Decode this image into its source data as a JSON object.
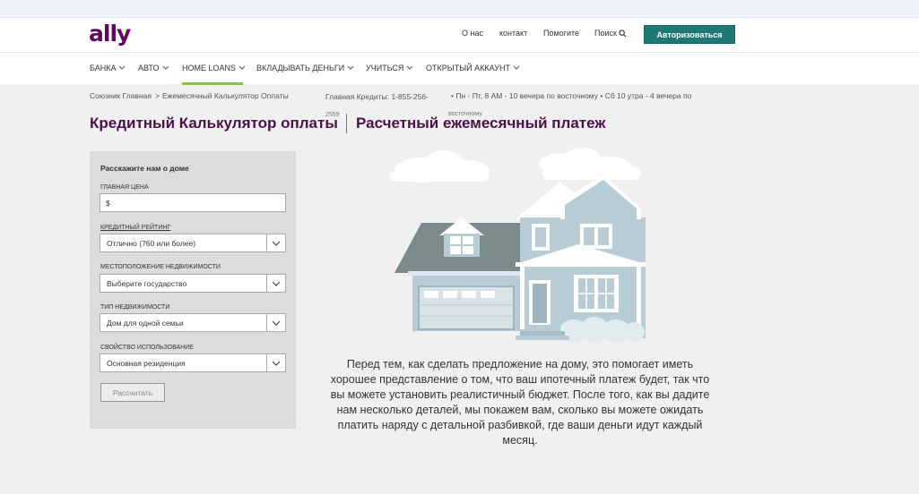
{
  "brand": {
    "logo": "ally",
    "accent": "#650360",
    "button_color": "#1b7a76"
  },
  "header": {
    "links": [
      "О нас",
      "контакт",
      "Помогите"
    ],
    "search_label": "Поиск",
    "login_label": "Авторизоваться"
  },
  "nav": {
    "items": [
      "БАНКА",
      "АВТО",
      "HOME LOANS",
      "ВКЛАДЫВАТЬ ДЕНЬГИ",
      "УЧИТЬСЯ",
      "ОТКРЫТЫЙ АККАУНТ"
    ],
    "active": "HOME LOANS"
  },
  "breadcrumb": {
    "home": "Союзник Главная",
    "separator": ">",
    "current": "Ежемесячный Калькулятор Оплаты"
  },
  "contact": {
    "phone": "Главная Кредиты: 1-855-256-",
    "phone_extra": "2559",
    "hours": "• Пн - Пт, 8 AM - 10 вечера по восточному  • Сб 10 утра - 4 вечера по",
    "hours_extra": "восточному"
  },
  "page": {
    "title_left": "Кредитный Калькулятор оплаты",
    "title_right": "Расчетный ежемесячный платеж"
  },
  "form": {
    "title": "Расскажите нам о доме",
    "price_label": "ГЛАВНАЯ ЦЕНА",
    "price_value": "$",
    "credit_label": "КРЕДИТНЫЙ РЕЙТИНГ",
    "credit_value": "Отлично (760 или более)",
    "location_label": "местоположение недвижимости",
    "location_value": "Выберите государство",
    "type_label": "тип недвижимости",
    "type_value": "Дом для одной семьи",
    "use_label": "свойство использование",
    "use_value": "Основная резиденция",
    "calculate_label": "Рассчитать"
  },
  "description": "Перед тем, как сделать предложение на дому, это помогает иметь хорошее представление о том, что ваш ипотечный платеж будет, так что вы можете установить реалистичный бюджет. После того, как вы дадите нам несколько деталей, мы покажем вам, сколько вы можете ожидать платить наряду с детальной разбивкой, где ваши деньги идут каждый месяц."
}
